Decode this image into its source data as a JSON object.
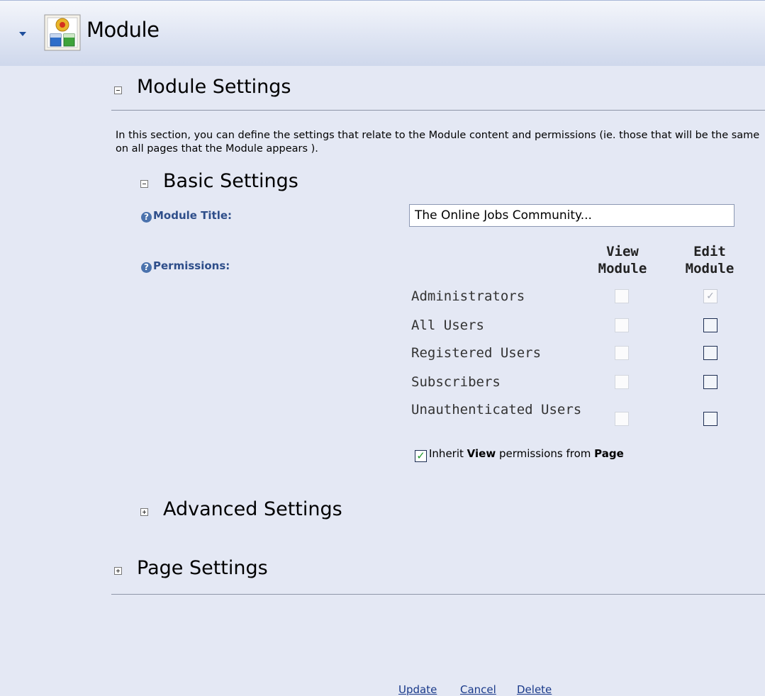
{
  "header": {
    "title": "Module",
    "icon": "module-icon"
  },
  "module_settings": {
    "title": "Module Settings",
    "intro": "In this section, you can define the settings that relate to the Module content and permissions (ie. those that will be the same on all pages that the Module appears )."
  },
  "basic_settings": {
    "title": "Basic Settings",
    "module_title_label": "Module Title:",
    "module_title_value": "The Online Jobs Community...",
    "permissions_label": "Permissions:",
    "col_view": "View Module",
    "col_edit": "Edit Module",
    "roles": [
      {
        "name": "Administrators",
        "view": false,
        "edit": true,
        "edit_disabled": true
      },
      {
        "name": "All Users",
        "view": false,
        "edit": false
      },
      {
        "name": "Registered Users",
        "view": false,
        "edit": false
      },
      {
        "name": "Subscribers",
        "view": false,
        "edit": false
      },
      {
        "name": "Unauthenticated Users",
        "view": false,
        "edit": false
      }
    ],
    "inherit": {
      "prefix": "Inherit ",
      "view": "View",
      "middle": " permissions from ",
      "page": "Page",
      "checked": true
    }
  },
  "advanced_settings": {
    "title": "Advanced Settings"
  },
  "page_settings": {
    "title": "Page Settings"
  },
  "actions": {
    "update": "Update",
    "cancel": "Cancel",
    "delete": "Delete"
  }
}
